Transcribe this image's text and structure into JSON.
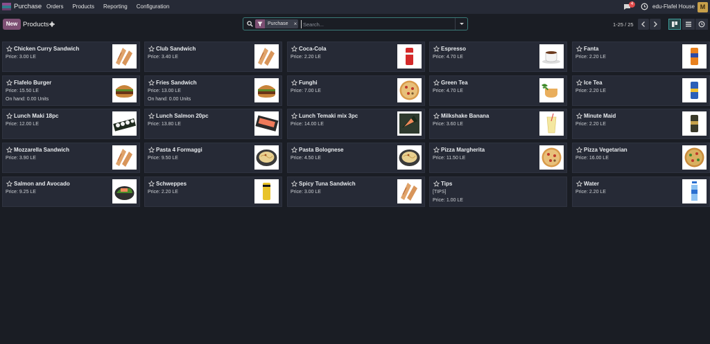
{
  "navbar": {
    "brand": "Purchase",
    "menu": [
      "Orders",
      "Products",
      "Reporting",
      "Configuration"
    ],
    "notification_count": "4",
    "company": "edu-Flafel House",
    "avatar_letter": "M"
  },
  "control_panel": {
    "new_label": "New",
    "title": "Products",
    "facet_label": "Purchase",
    "facet_remove": "×",
    "search_placeholder": "Search...",
    "pager": "1-25 / 25"
  },
  "colors": {
    "accent": "#7d4f73",
    "teal": "#3f9c99",
    "card_bg": "#262a36",
    "page_bg": "#1a1d24"
  },
  "products": [
    {
      "name": "Chicken Curry Sandwich",
      "line1": "Price: 3.00 LE",
      "line2": "",
      "icon": "sandwich-image"
    },
    {
      "name": "Club Sandwich",
      "line1": "Price: 3.40 LE",
      "line2": "",
      "icon": "sandwich-image"
    },
    {
      "name": "Coca-Cola",
      "line1": "Price: 2.20 LE",
      "line2": "",
      "icon": "red-can-image"
    },
    {
      "name": "Espresso",
      "line1": "Price: 4.70 LE",
      "line2": "",
      "icon": "coffee-cup-image"
    },
    {
      "name": "Fanta",
      "line1": "Price: 2.20 LE",
      "line2": "",
      "icon": "orange-can-image"
    },
    {
      "name": "Flafelo Burger",
      "line1": "Price: 15.50 LE",
      "line2": "On hand: 0.00 Units",
      "icon": "burger-image"
    },
    {
      "name": "Fries Sandwich",
      "line1": "Price: 13.00 LE",
      "line2": "On hand: 0.00 Units",
      "icon": "burger-image"
    },
    {
      "name": "Funghi",
      "line1": "Price: 7.00 LE",
      "line2": "",
      "icon": "pizza-image"
    },
    {
      "name": "Green Tea",
      "line1": "Price: 4.70 LE",
      "line2": "",
      "icon": "tea-cup-image"
    },
    {
      "name": "Ice Tea",
      "line1": "Price: 2.20 LE",
      "line2": "",
      "icon": "blue-can-image"
    },
    {
      "name": "Lunch Maki 18pc",
      "line1": "Price: 12.00 LE",
      "line2": "",
      "icon": "maki-image"
    },
    {
      "name": "Lunch Salmon 20pc",
      "line1": "Price: 13.80 LE",
      "line2": "",
      "icon": "salmon-image"
    },
    {
      "name": "Lunch Temaki mix 3pc",
      "line1": "Price: 14.00 LE",
      "line2": "",
      "icon": "temaki-image"
    },
    {
      "name": "Milkshake Banana",
      "line1": "Price: 3.60 LE",
      "line2": "",
      "icon": "milkshake-image"
    },
    {
      "name": "Minute Maid",
      "line1": "Price: 2.20 LE",
      "line2": "",
      "icon": "dark-can-image"
    },
    {
      "name": "Mozzarella Sandwich",
      "line1": "Price: 3.90 LE",
      "line2": "",
      "icon": "sandwich-image"
    },
    {
      "name": "Pasta 4 Formaggi",
      "line1": "Price: 9.50 LE",
      "line2": "",
      "icon": "pasta-image"
    },
    {
      "name": "Pasta Bolognese",
      "line1": "Price: 4.50 LE",
      "line2": "",
      "icon": "pasta-image"
    },
    {
      "name": "Pizza Margherita",
      "line1": "Price: 11.50 LE",
      "line2": "",
      "icon": "pizza-image"
    },
    {
      "name": "Pizza Vegetarian",
      "line1": "Price: 16.00 LE",
      "line2": "",
      "icon": "pizza-veg-image"
    },
    {
      "name": "Salmon and Avocado",
      "line1": "Price: 9.25 LE",
      "line2": "",
      "icon": "salad-image"
    },
    {
      "name": "Schweppes",
      "line1": "Price: 2.20 LE",
      "line2": "",
      "icon": "yellow-can-image"
    },
    {
      "name": "Spicy Tuna Sandwich",
      "line1": "Price: 3.00 LE",
      "line2": "",
      "icon": "sandwich-image"
    },
    {
      "name": "Tips",
      "line1": "[TIPS]",
      "line2": "Price: 1.00 LE",
      "icon": ""
    },
    {
      "name": "Water",
      "line1": "Price: 2.20 LE",
      "line2": "",
      "icon": "water-bottle-image"
    }
  ]
}
